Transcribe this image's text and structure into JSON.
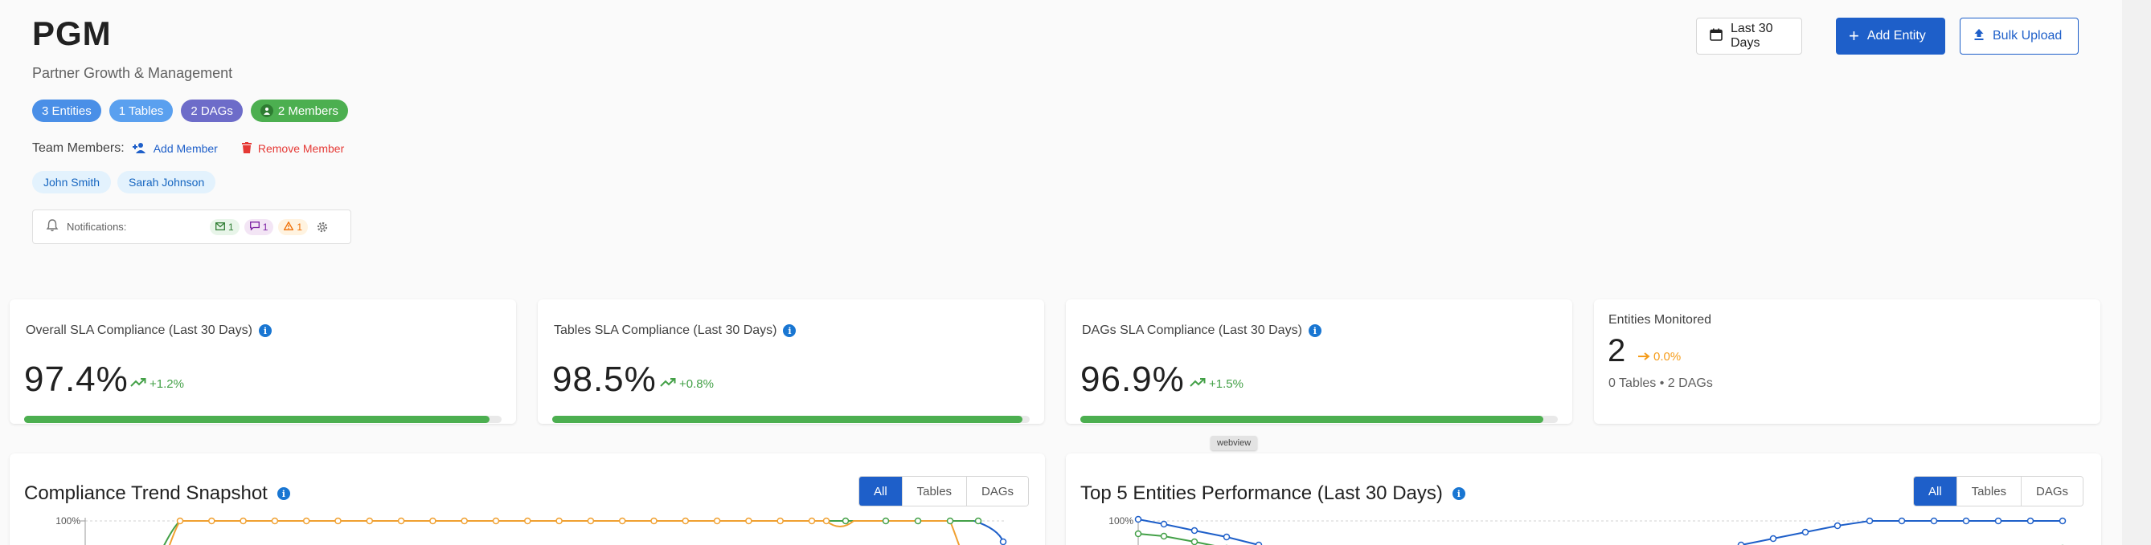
{
  "header": {
    "title": "PGM",
    "subtitle": "Partner Growth & Management",
    "badges": [
      {
        "label": "3 Entities",
        "color": "#4a8fe7"
      },
      {
        "label": "1 Tables",
        "color": "#5aa0ef"
      },
      {
        "label": "2 DAGs",
        "color": "#6d6cc9"
      },
      {
        "label": "2 Members",
        "color": "#4caf50",
        "icon": "person-icon"
      }
    ],
    "team_members_label": "Team Members:",
    "add_member_label": "Add Member",
    "remove_member_label": "Remove Member",
    "members": [
      "John Smith",
      "Sarah Johnson"
    ],
    "notifications": {
      "label": "Notifications:",
      "email_count": "1",
      "chat_count": "1",
      "alert_count": "1"
    }
  },
  "toolbar": {
    "date_range_label": "Last 30 Days",
    "add_entity_label": "Add Entity",
    "bulk_upload_label": "Bulk Upload"
  },
  "kpis": [
    {
      "label": "Overall SLA Compliance (Last 30 Days)",
      "value": "97.4%",
      "delta": "+1.2%",
      "progress": 0.974
    },
    {
      "label": "Tables SLA Compliance (Last 30 Days)",
      "value": "98.5%",
      "delta": "+0.8%",
      "progress": 0.985
    },
    {
      "label": "DAGs SLA Compliance (Last 30 Days)",
      "value": "96.9%",
      "delta": "+1.5%",
      "progress": 0.969
    }
  ],
  "entities_monitored": {
    "label": "Entities Monitored",
    "value": "2",
    "delta": "0.0%",
    "breakdown": "0 Tables • 2 DAGs"
  },
  "tooltip": "webview",
  "compliance_trend": {
    "title": "Compliance Trend Snapshot",
    "filters": [
      "All",
      "Tables",
      "DAGs"
    ],
    "active_filter": "All",
    "y_tick": "100%"
  },
  "top_entities": {
    "title": "Top 5 Entities Performance (Last 30 Days)",
    "filters": [
      "All",
      "Tables",
      "DAGs"
    ],
    "active_filter": "All",
    "y_tick": "100%"
  },
  "colors": {
    "primary": "#1e5fc9",
    "success": "#4caf50",
    "warning": "#f59c1a",
    "danger": "#e53935",
    "series_orange": "#f0a030",
    "series_green": "#43a047",
    "series_blue": "#1e5fc9"
  }
}
